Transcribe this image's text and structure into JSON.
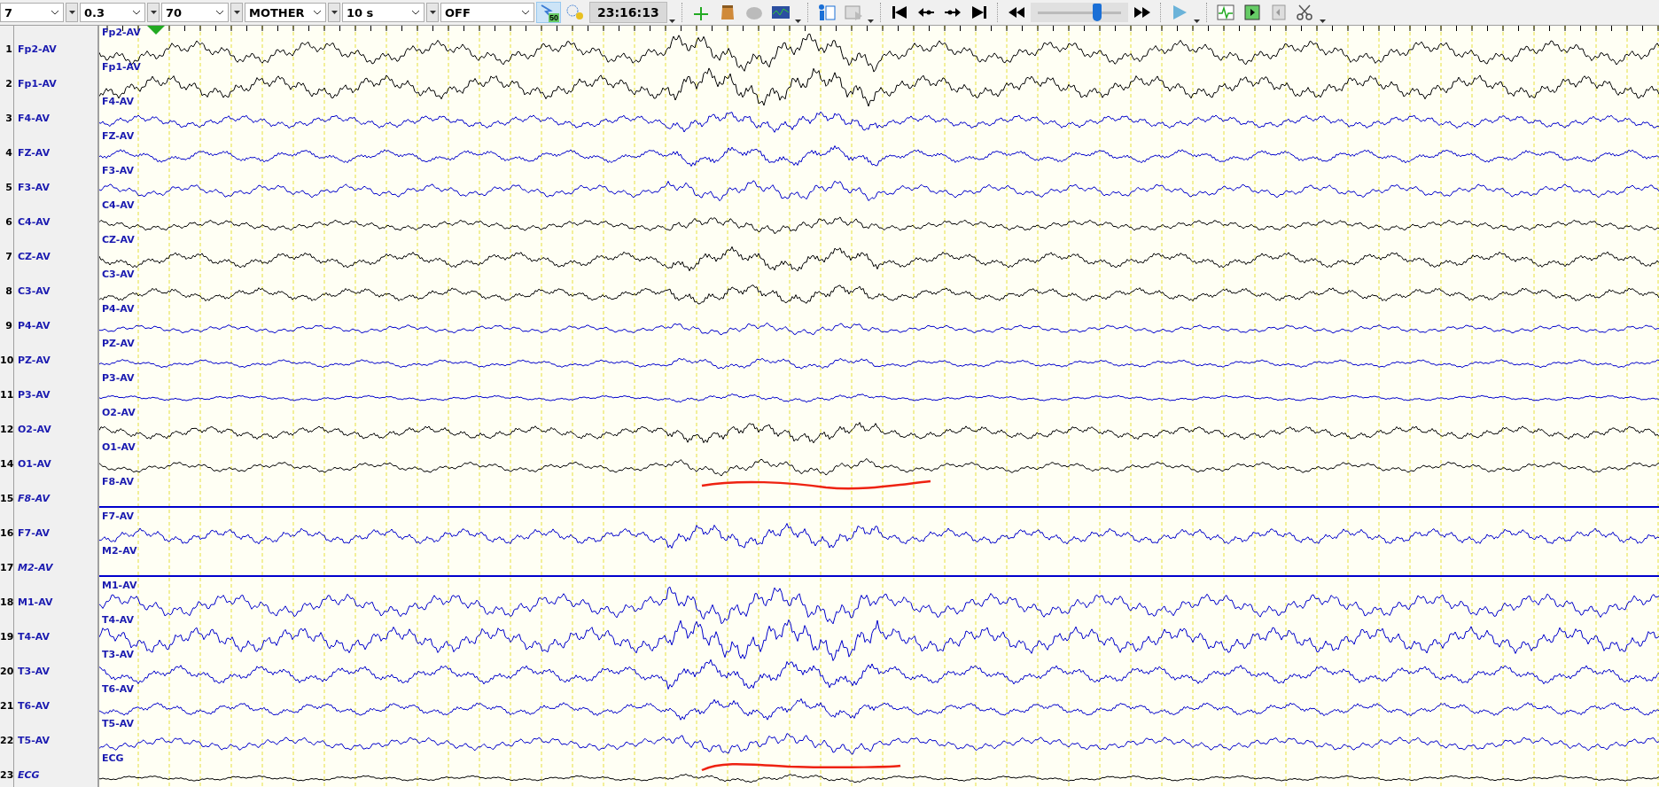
{
  "toolbar": {
    "combos": [
      {
        "value": "7"
      },
      {
        "value": "0.3"
      },
      {
        "value": "70"
      },
      {
        "value": "MOTHER"
      },
      {
        "value": "10 s"
      },
      {
        "value": "OFF"
      }
    ],
    "notch_label": "50",
    "time": "23:16:13",
    "speed_slider": {
      "level": 0.72
    }
  },
  "channels": [
    {
      "number": "1",
      "name": "Fp2-AV",
      "trace_label": "Fp2-AV",
      "color": "#000000",
      "disabled": false
    },
    {
      "number": "2",
      "name": "Fp1-AV",
      "trace_label": "Fp1-AV",
      "color": "#000000",
      "disabled": false
    },
    {
      "number": "3",
      "name": "F4-AV",
      "trace_label": "F4-AV",
      "color": "#0000cc",
      "disabled": false
    },
    {
      "number": "4",
      "name": "FZ-AV",
      "trace_label": "FZ-AV",
      "color": "#0000cc",
      "disabled": false
    },
    {
      "number": "5",
      "name": "F3-AV",
      "trace_label": "F3-AV",
      "color": "#0000cc",
      "disabled": false
    },
    {
      "number": "6",
      "name": "C4-AV",
      "trace_label": "C4-AV",
      "color": "#000000",
      "disabled": false
    },
    {
      "number": "7",
      "name": "CZ-AV",
      "trace_label": "CZ-AV",
      "color": "#000000",
      "disabled": false
    },
    {
      "number": "8",
      "name": "C3-AV",
      "trace_label": "C3-AV",
      "color": "#000000",
      "disabled": false
    },
    {
      "number": "9",
      "name": "P4-AV",
      "trace_label": "P4-AV",
      "color": "#0000cc",
      "disabled": false
    },
    {
      "number": "10",
      "name": "PZ-AV",
      "trace_label": "PZ-AV",
      "color": "#0000cc",
      "disabled": false
    },
    {
      "number": "11",
      "name": "P3-AV",
      "trace_label": "P3-AV",
      "color": "#0000cc",
      "disabled": false
    },
    {
      "number": "12",
      "name": "O2-AV",
      "trace_label": "O2-AV",
      "color": "#000000",
      "disabled": false
    },
    {
      "number": "14",
      "name": "O1-AV",
      "trace_label": "O1-AV",
      "color": "#000000",
      "disabled": false
    },
    {
      "number": "15",
      "name": "F8-AV",
      "trace_label": "F8-AV",
      "color": "#0000cc",
      "disabled": true
    },
    {
      "number": "16",
      "name": "F7-AV",
      "trace_label": "F7-AV",
      "color": "#0000cc",
      "disabled": false
    },
    {
      "number": "17",
      "name": "M2-AV",
      "trace_label": "M2-AV",
      "color": "#0000cc",
      "disabled": true
    },
    {
      "number": "18",
      "name": "M1-AV",
      "trace_label": "M1-AV",
      "color": "#0000cc",
      "disabled": false
    },
    {
      "number": "19",
      "name": "T4-AV",
      "trace_label": "T4-AV",
      "color": "#0000cc",
      "disabled": false
    },
    {
      "number": "20",
      "name": "T3-AV",
      "trace_label": "T3-AV",
      "color": "#0000cc",
      "disabled": false
    },
    {
      "number": "21",
      "name": "T6-AV",
      "trace_label": "T6-AV",
      "color": "#0000cc",
      "disabled": false
    },
    {
      "number": "22",
      "name": "T5-AV",
      "trace_label": "T5-AV",
      "color": "#0000cc",
      "disabled": false
    },
    {
      "number": "23",
      "name": "ECG",
      "trace_label": "ECG",
      "color": "#000000",
      "disabled": true
    }
  ]
}
